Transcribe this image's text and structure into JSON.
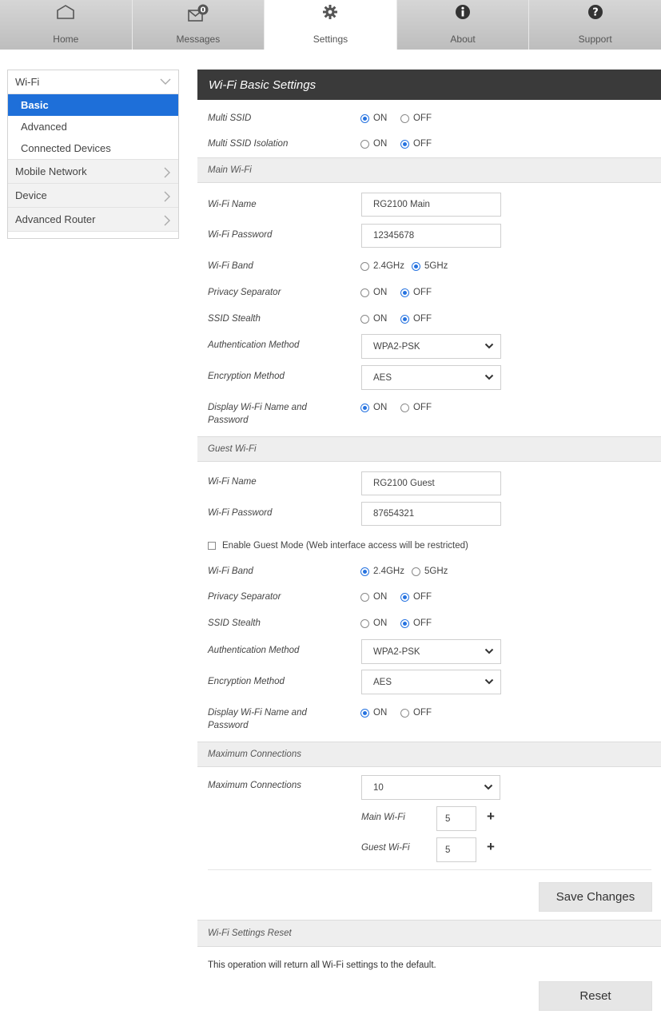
{
  "nav": {
    "tabs": [
      {
        "label": "Home",
        "icon": "home-icon"
      },
      {
        "label": "Messages",
        "icon": "messages-icon",
        "badge": "0"
      },
      {
        "label": "Settings",
        "icon": "gear-icon",
        "active": true
      },
      {
        "label": "About",
        "icon": "info-icon"
      },
      {
        "label": "Support",
        "icon": "help-icon"
      }
    ]
  },
  "sidebar": {
    "wifi": "Wi-Fi",
    "wifi_items": [
      "Basic",
      "Advanced",
      "Connected Devices"
    ],
    "mobile_network": "Mobile Network",
    "device": "Device",
    "advanced_router": "Advanced Router"
  },
  "panel": {
    "title": "Wi-Fi Basic Settings",
    "on": "ON",
    "off": "OFF",
    "band_24": "2.4GHz",
    "band_5": "5GHz",
    "multi_ssid": "Multi SSID",
    "multi_ssid_value": "ON",
    "multi_ssid_isolation": "Multi SSID Isolation",
    "multi_ssid_isolation_value": "OFF",
    "main": {
      "section": "Main Wi-Fi",
      "name_label": "Wi-Fi Name",
      "name_value": "RG2100 Main",
      "password_label": "Wi-Fi Password",
      "password_value": "12345678",
      "band_label": "Wi-Fi Band",
      "band_value": "5GHz",
      "privacy_label": "Privacy Separator",
      "privacy_value": "OFF",
      "stealth_label": "SSID Stealth",
      "stealth_value": "OFF",
      "auth_label": "Authentication Method",
      "auth_value": "WPA2-PSK",
      "enc_label": "Encryption Method",
      "enc_value": "AES",
      "display_label_1": "Display Wi-Fi Name and",
      "display_label_2": "Password",
      "display_value": "ON"
    },
    "guest": {
      "section": "Guest Wi-Fi",
      "name_label": "Wi-Fi Name",
      "name_value": "RG2100 Guest",
      "password_label": "Wi-Fi Password",
      "password_value": "87654321",
      "guest_mode": "Enable Guest Mode (Web interface access will be restricted)",
      "band_label": "Wi-Fi Band",
      "band_value": "2.4GHz",
      "privacy_label": "Privacy Separator",
      "privacy_value": "OFF",
      "stealth_label": "SSID Stealth",
      "stealth_value": "OFF",
      "auth_label": "Authentication Method",
      "auth_value": "WPA2-PSK",
      "enc_label": "Encryption Method",
      "enc_value": "AES",
      "display_label_1": "Display Wi-Fi Name and",
      "display_label_2": "Password",
      "display_value": "ON"
    },
    "max": {
      "section": "Maximum Connections",
      "label": "Maximum Connections",
      "value": "10",
      "main_label": "Main Wi-Fi",
      "main_value": "5",
      "guest_label": "Guest Wi-Fi",
      "guest_value": "5"
    },
    "save_button": "Save Changes",
    "reset": {
      "section": "Wi-Fi Settings Reset",
      "note": "This operation will return all Wi-Fi settings to the default.",
      "button": "Reset"
    }
  },
  "colors": {
    "accent": "#1e6fd9",
    "header": "#3a3a3a",
    "radio": "#2673e0"
  }
}
